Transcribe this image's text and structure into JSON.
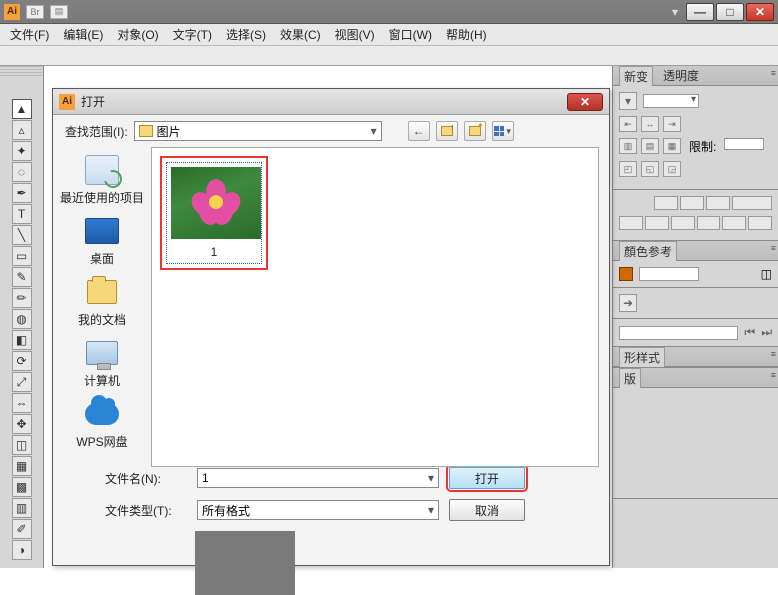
{
  "app": {
    "logo": "Ai"
  },
  "window_buttons": {
    "min": "—",
    "max": "□",
    "close": "✕"
  },
  "menu": {
    "file": "文件(F)",
    "edit": "编辑(E)",
    "object": "对象(O)",
    "type": "文字(T)",
    "select": "选择(S)",
    "effect": "效果(C)",
    "view": "视图(V)",
    "window": "窗口(W)",
    "help": "帮助(H)"
  },
  "right_panels": {
    "p1": {
      "tab1": "新变",
      "tab2": "透明度",
      "limit_label": "限制:"
    },
    "p2": {
      "tab1": "顏色参考"
    },
    "p3": {
      "tab1": "形样式"
    },
    "p4": {
      "tab1": "版"
    }
  },
  "dialog": {
    "title": "打开",
    "lookin_label": "查找范围(I):",
    "lookin_value": "图片",
    "nav": {
      "back": "←",
      "up": "up",
      "new": "new",
      "view": "view"
    },
    "places": {
      "recent": "最近使用的项目",
      "desktop": "桌面",
      "mydocs": "我的文档",
      "computer": "计算机",
      "wps": "WPS网盘"
    },
    "files": [
      {
        "name": "1"
      }
    ],
    "filename_label": "文件名(N):",
    "filename_value": "1",
    "filetype_label": "文件类型(T):",
    "filetype_value": "所有格式",
    "open_btn": "打开",
    "cancel_btn": "取消"
  }
}
